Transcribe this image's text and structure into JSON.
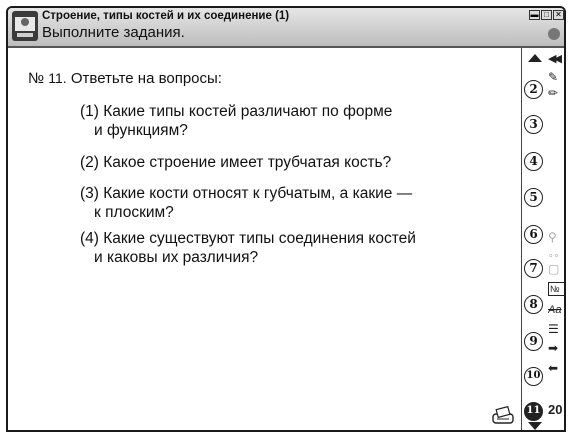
{
  "window": {
    "title": "Строение, типы костей и их соединение (1)",
    "subtitle": "Выполните задания."
  },
  "task": {
    "number_prefix": "№",
    "number": "11.",
    "heading": "Ответьте на вопросы:",
    "questions": [
      {
        "line1": "(1) Какие типы костей различают по форме",
        "line2": "и функциям?"
      },
      {
        "line1": "(2) Какое строение имеет трубчатая кость?",
        "line2": ""
      },
      {
        "line1": "(3) Какие кости относят к губчатым, а какие —",
        "line2": "к плоским?"
      },
      {
        "line1": "(4) Какие существуют типы соединения костей",
        "line2": "и каковы их различия?"
      }
    ]
  },
  "pages": [
    "2",
    "3",
    "4",
    "5",
    "6",
    "7",
    "8",
    "9",
    "10",
    "11"
  ],
  "active_page": "11",
  "tools": {
    "back_label": "◀◀",
    "number_tool_label": "№",
    "text_tool_label": "Аа",
    "year_label": "20"
  },
  "icons": [
    "app-icon",
    "minimize-icon",
    "maximize-icon",
    "close-icon",
    "stop-icon",
    "scroll-up-icon",
    "scroll-down-icon",
    "printer-icon",
    "wrench-icon",
    "pencil-icon",
    "magnifier-icon",
    "cube-icon",
    "list-icon",
    "arrow-right-icon",
    "arrow-left-icon"
  ]
}
